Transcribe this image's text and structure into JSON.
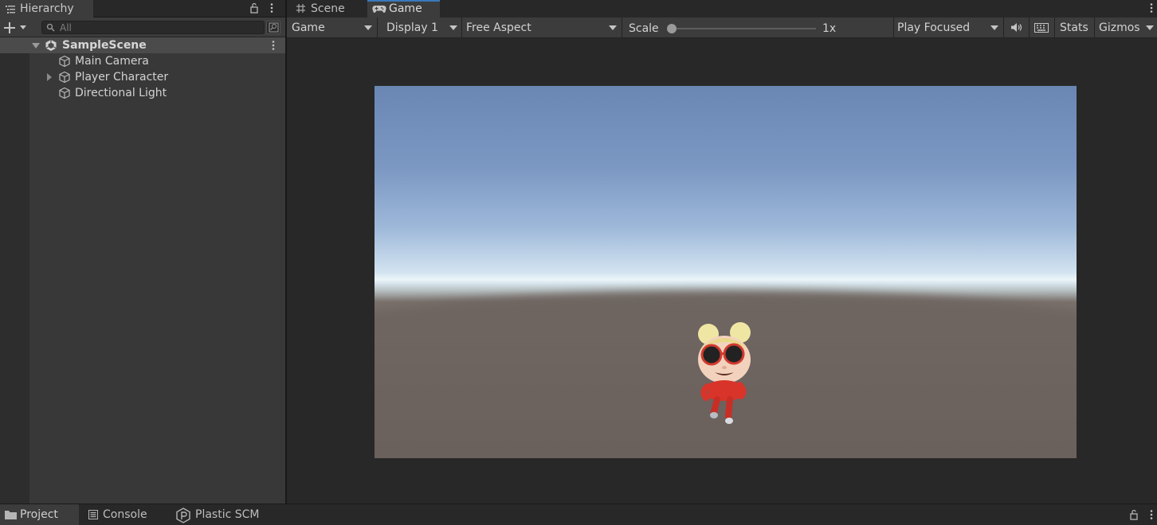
{
  "hierarchy": {
    "tab_label": "Hierarchy",
    "search_placeholder": "All",
    "scene_name": "SampleScene",
    "items": [
      {
        "label": "Main Camera"
      },
      {
        "label": "Player Character"
      },
      {
        "label": "Directional Light"
      }
    ]
  },
  "game_view": {
    "tabs": [
      {
        "label": "Scene"
      },
      {
        "label": "Game"
      }
    ],
    "toolbar": {
      "mode": "Game",
      "display": "Display 1",
      "aspect": "Free Aspect",
      "scale_label": "Scale",
      "scale_value": "1x",
      "scale_fraction": 0.0,
      "play_mode": "Play Focused",
      "stats": "Stats",
      "gizmos": "Gizmos"
    }
  },
  "bottom_tabs": [
    {
      "label": "Project"
    },
    {
      "label": "Console"
    },
    {
      "label": "Plastic SCM"
    }
  ],
  "colors": {
    "accent": "#3a79bb",
    "panel": "#3c3c3c",
    "selected_row": "#4b4b4b"
  },
  "icons": [
    "list-icon",
    "lock-icon",
    "kebab-menu-icon",
    "plus-icon",
    "search-icon",
    "unity-scene-icon",
    "gameobject-icon",
    "grid-icon",
    "gamepad-icon",
    "speaker-icon",
    "keyboard-icon",
    "folder-icon",
    "console-icon",
    "plastic-scm-icon"
  ]
}
